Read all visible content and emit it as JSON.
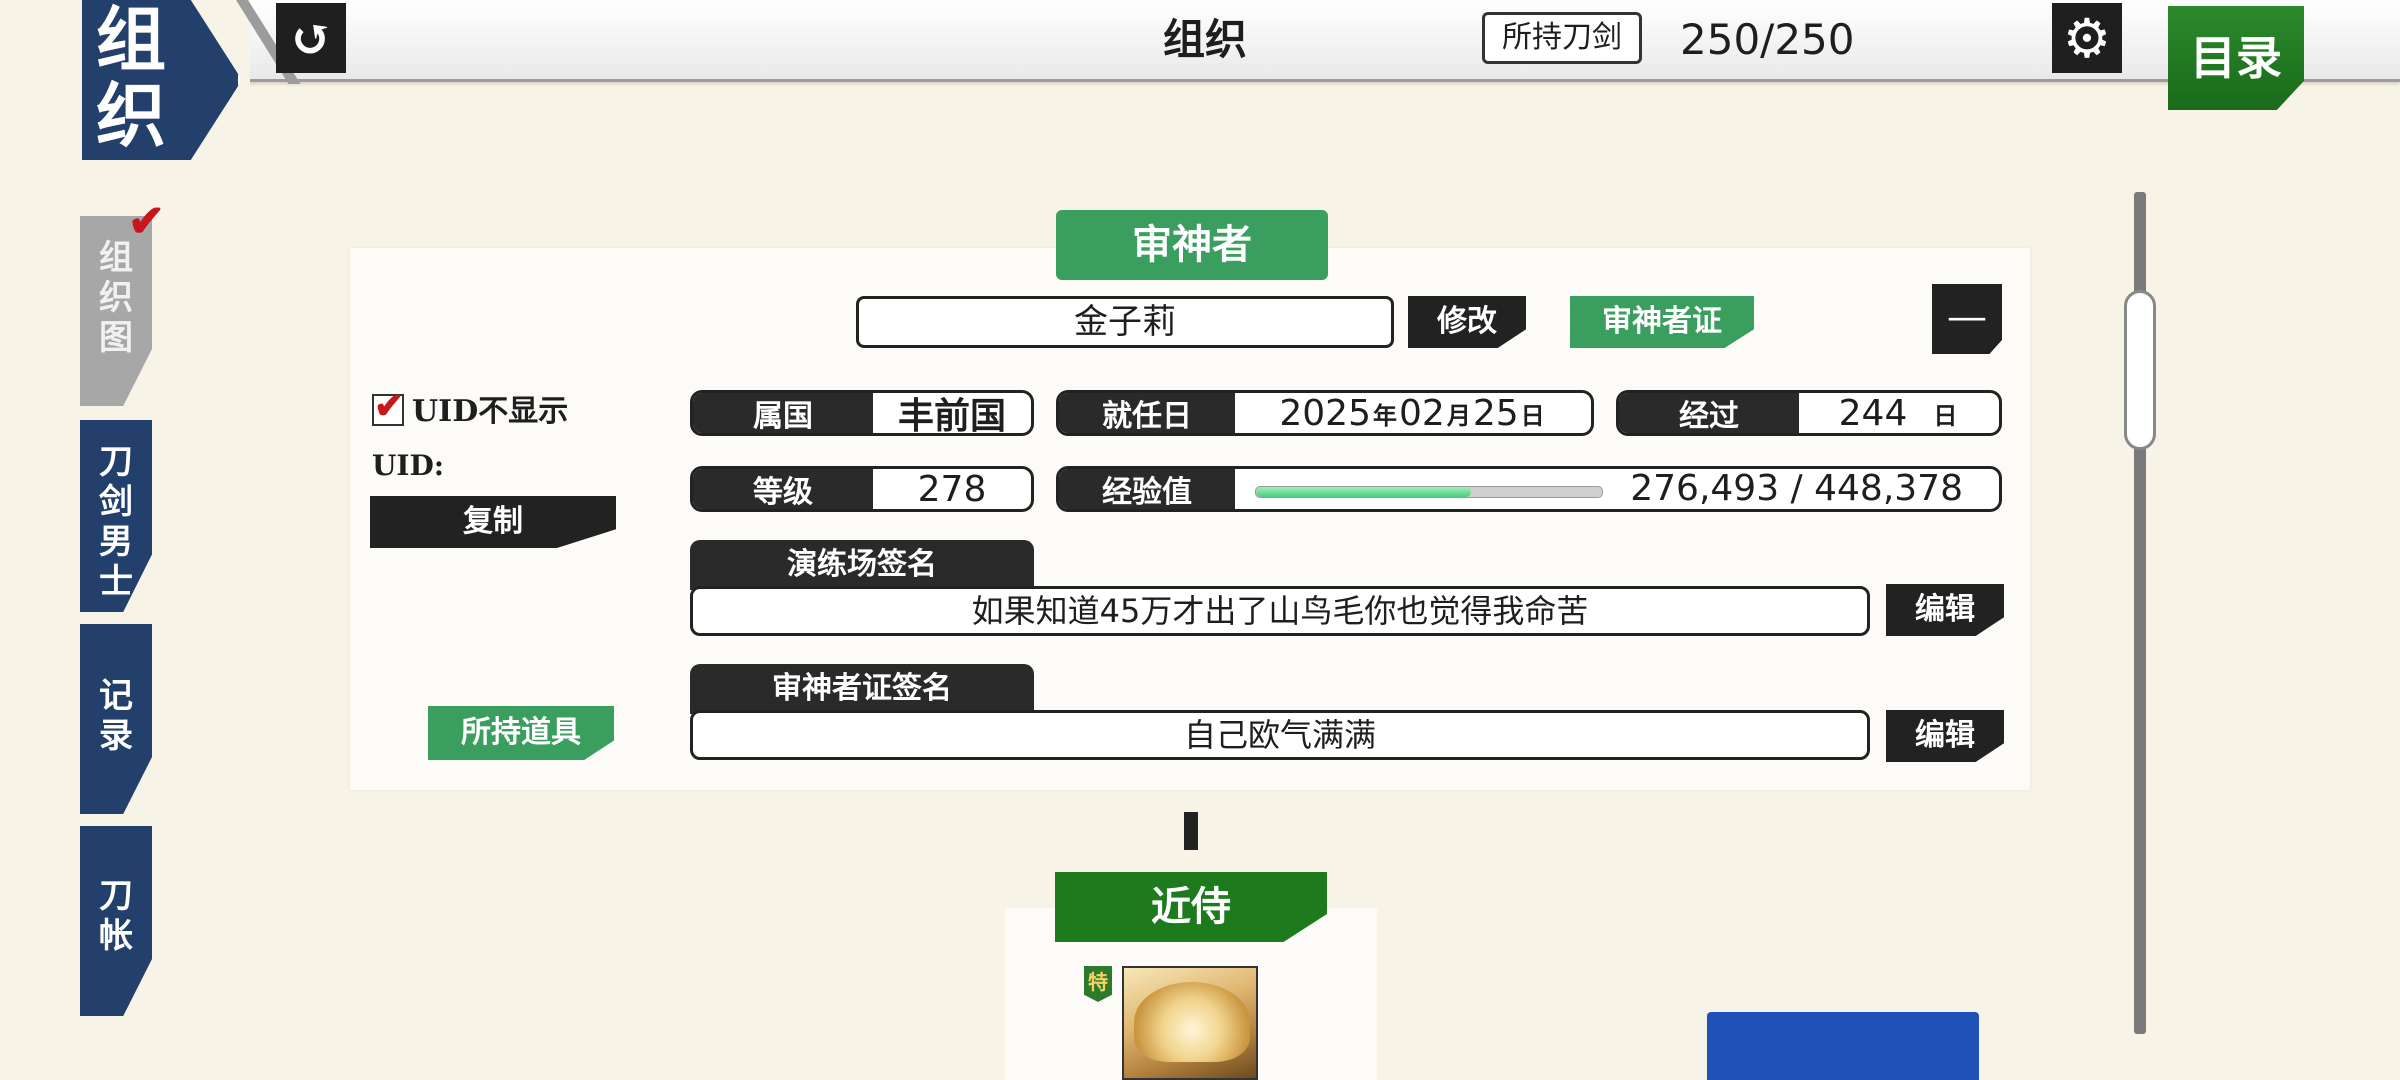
{
  "header": {
    "corner_title_line1": "组",
    "corner_title_line2": "织",
    "page_title": "组织",
    "sword_label": "所持刀剑",
    "sword_count": "250/250",
    "menu_label": "目录",
    "back_icon": "↺",
    "settings_icon": "⚙"
  },
  "side_tabs": [
    {
      "label": "组织图",
      "active": true
    },
    {
      "label": "刀剑男士",
      "active": false
    },
    {
      "label": "记录",
      "active": false
    },
    {
      "label": "刀帐",
      "active": false
    }
  ],
  "profile": {
    "section_title": "审神者",
    "name": "金子莉",
    "rename_label": "修改",
    "card_label": "审神者证",
    "collapse_icon": "—",
    "uid_hide_label": "UID不显示",
    "uid_hidden": true,
    "uid_label": "UID:",
    "copy_label": "复制",
    "items_label": "所持道具",
    "country_label": "属国",
    "country_value": "丰前国",
    "start_label": "就任日",
    "start_year": "2025",
    "start_month": "02",
    "start_day": "25",
    "unit_year": "年",
    "unit_month": "月",
    "unit_day": "日",
    "elapsed_label": "经过",
    "elapsed_value": "244",
    "level_label": "等级",
    "level_value": "278",
    "exp_label": "经验值",
    "exp_text": "276,493 / 448,378",
    "exp_progress": 0.62,
    "sig1_label": "演练场签名",
    "sig1_text": "如果知道45万才出了山鸟毛你也觉得我命苦",
    "sig2_label": "审神者证签名",
    "sig2_text": "自己欧气满满",
    "edit_label": "编辑"
  },
  "attendant": {
    "title": "近侍",
    "rank_badge": "特"
  },
  "colors": {
    "navy": "#233f6b",
    "green": "#3a9e5e",
    "dark_green": "#1d7a1d",
    "check_red": "#c8161d",
    "background": "#f7f3e6"
  }
}
